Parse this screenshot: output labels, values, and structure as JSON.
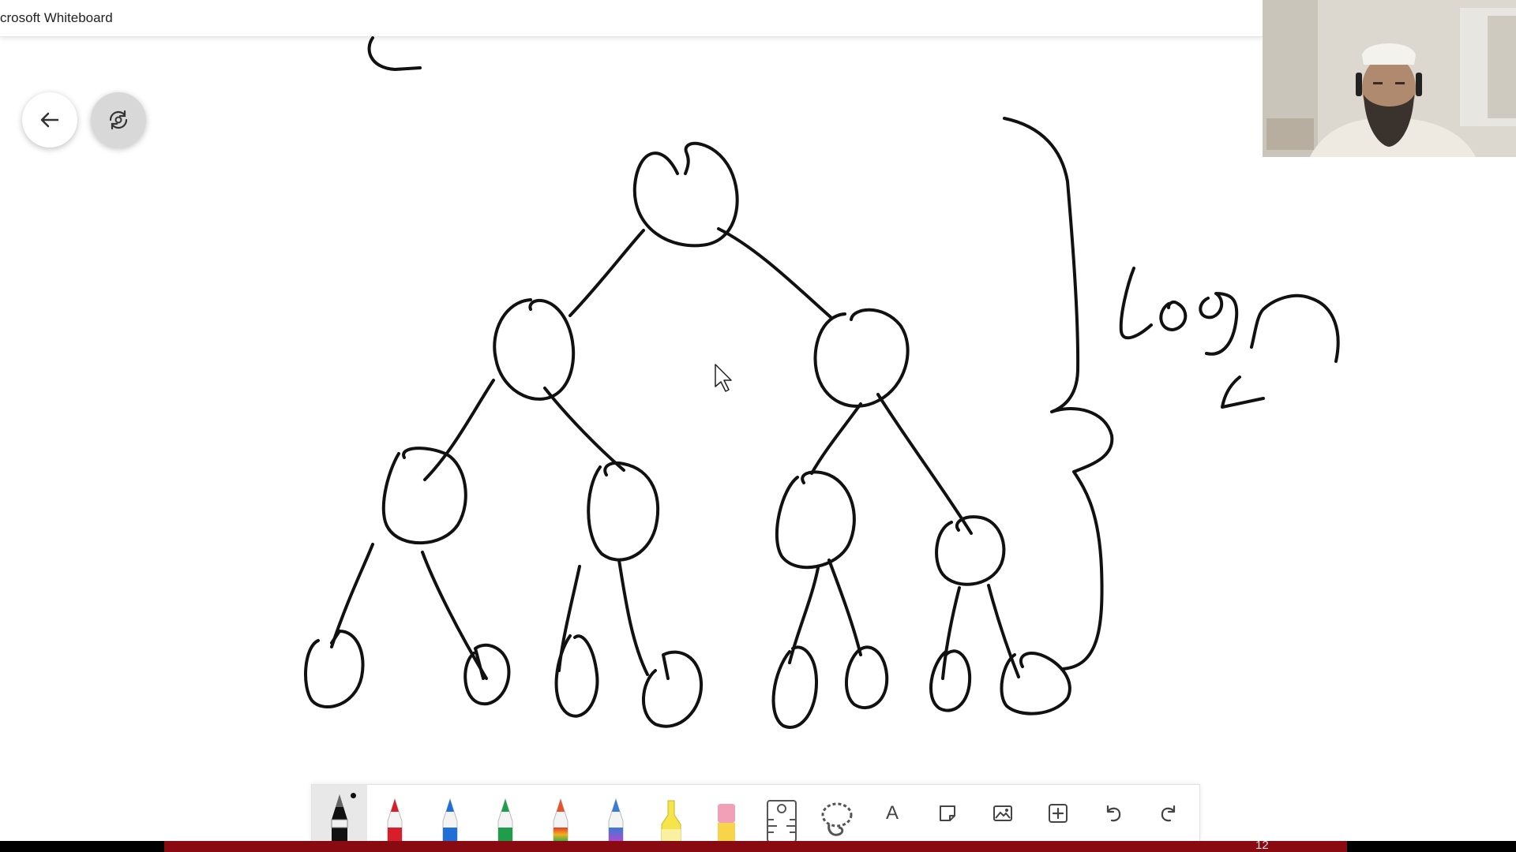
{
  "window": {
    "title": "crosoft Whiteboard"
  },
  "nav": {
    "back_icon": "arrow-left-icon",
    "replay_icon": "ink-replay-icon"
  },
  "board": {
    "annotation": "log n",
    "ink_color": "#111111"
  },
  "toolbar": {
    "tools": [
      {
        "name": "black-pen",
        "color": "#111111",
        "selected": true
      },
      {
        "name": "red-pen",
        "color": "#d81e2a"
      },
      {
        "name": "blue-pen",
        "color": "#1e6fd8"
      },
      {
        "name": "green-pen",
        "color": "#1e9e4a"
      },
      {
        "name": "rainbow-pen",
        "color": "#e5532a"
      },
      {
        "name": "galaxy-pen",
        "color": "#3a7bd5"
      },
      {
        "name": "highlighter",
        "color": "#f5e44a"
      },
      {
        "name": "eraser",
        "color": "#f2a0b8"
      },
      {
        "name": "ruler",
        "icon": "ruler-icon"
      },
      {
        "name": "lasso",
        "icon": "lasso-icon"
      }
    ],
    "text_tool": "A",
    "actions": [
      "note-icon",
      "image-icon",
      "add-icon",
      "undo-icon",
      "redo-icon"
    ]
  },
  "status": {
    "page_number": "12",
    "progress_color": "#8a0a12"
  }
}
